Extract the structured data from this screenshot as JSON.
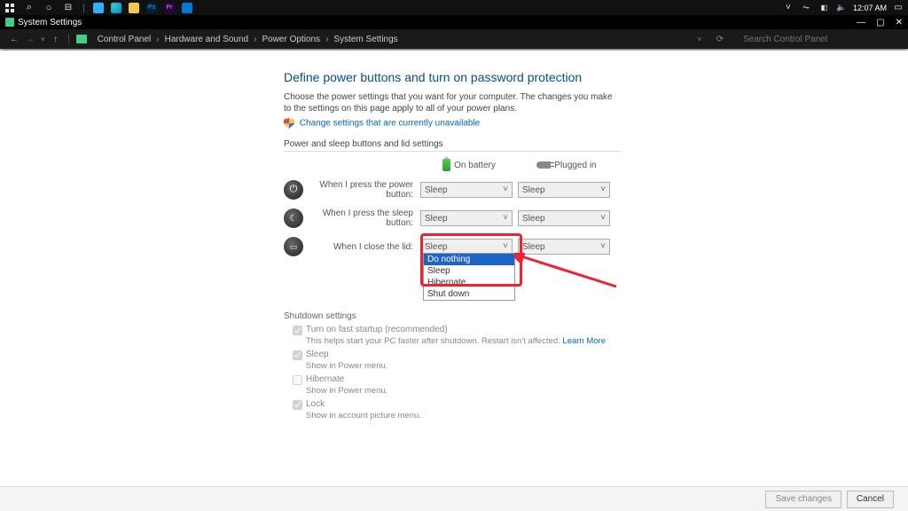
{
  "taskbar": {
    "clock": "12:07 AM",
    "apps_tooltip": [
      "Windows",
      "Search",
      "Cortana",
      "Task View",
      "",
      "App",
      "Edge",
      "Explorer",
      "Photoshop",
      "Premiere",
      "Settings"
    ]
  },
  "window": {
    "title": "System Settings"
  },
  "nav": {
    "breadcrumbs": [
      "Control Panel",
      "Hardware and Sound",
      "Power Options",
      "System Settings"
    ],
    "search_placeholder": "Search Control Panel"
  },
  "page": {
    "heading": "Define power buttons and turn on password protection",
    "subtitle": "Choose the power settings that you want for your computer. The changes you make to the settings on this page apply to all of your power plans.",
    "change_unavailable": "Change settings that are currently unavailable",
    "section1": "Power and sleep buttons and lid settings",
    "col_battery": "On battery",
    "col_plugged": "Plugged in",
    "rows": [
      {
        "label": "When I press the power button:",
        "battery": "Sleep",
        "plugged": "Sleep"
      },
      {
        "label": "When I press the sleep button:",
        "battery": "Sleep",
        "plugged": "Sleep"
      },
      {
        "label": "When I close the lid:",
        "battery": "Sleep",
        "plugged": "Sleep"
      }
    ],
    "dropdown_options": [
      "Do nothing",
      "Sleep",
      "Hibernate",
      "Shut down"
    ],
    "dropdown_selected_index": 0,
    "shutdown": {
      "label": "Shutdown settings",
      "fast_startup": "Turn on fast startup (recommended)",
      "fast_help_prefix": "This helps start your PC faster after shutdown. Restart isn't affected. ",
      "learn_more": "Learn More",
      "sleep": "Sleep",
      "sleep_help": "Show in Power menu.",
      "hibernate": "Hibernate",
      "hibernate_help": "Show in Power menu.",
      "lock": "Lock",
      "lock_help": "Show in account picture menu."
    }
  },
  "footer": {
    "save": "Save changes",
    "cancel": "Cancel"
  }
}
